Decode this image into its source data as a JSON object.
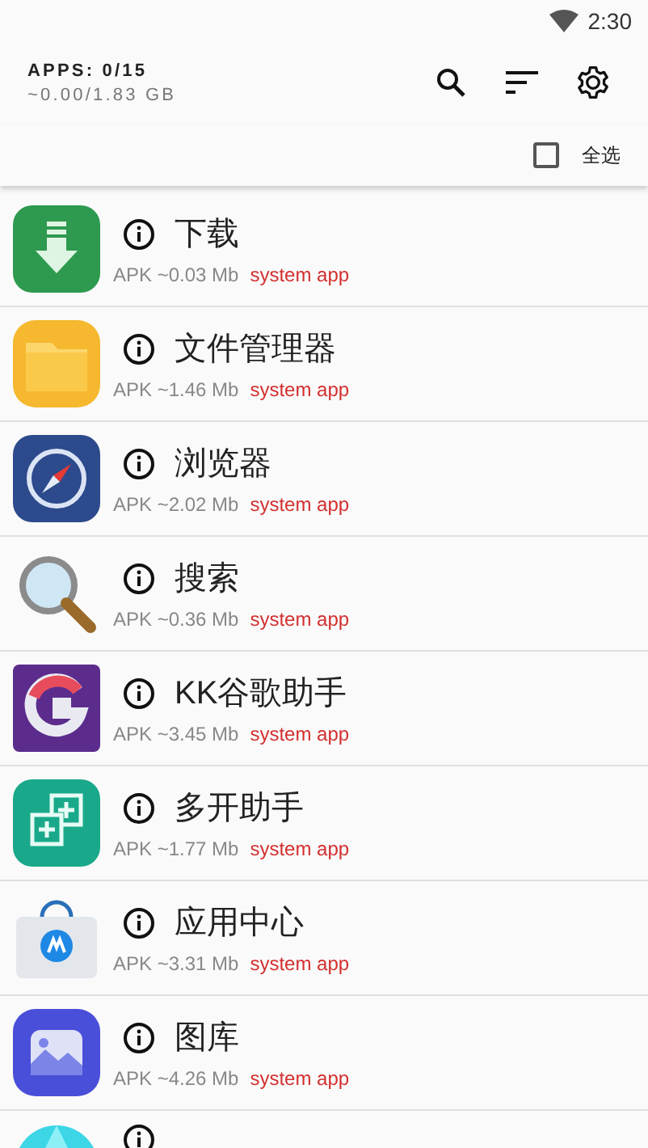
{
  "status_bar": {
    "time": "2:30"
  },
  "header": {
    "title": "APPS: 0/15",
    "subtitle": "~0.00/1.83 GB"
  },
  "select_all": {
    "label": "全选",
    "checked": false
  },
  "apps": [
    {
      "name": "下载",
      "size": "APK ~0.03 Mb",
      "tag": "system app",
      "kind": "download"
    },
    {
      "name": "文件管理器",
      "size": "APK ~1.46 Mb",
      "tag": "system app",
      "kind": "folder"
    },
    {
      "name": "浏览器",
      "size": "APK ~2.02 Mb",
      "tag": "system app",
      "kind": "compass"
    },
    {
      "name": "搜索",
      "size": "APK ~0.36 Mb",
      "tag": "system app",
      "kind": "magnifier"
    },
    {
      "name": "KK谷歌助手",
      "size": "APK ~3.45 Mb",
      "tag": "system app",
      "kind": "letter"
    },
    {
      "name": "多开助手",
      "size": "APK ~1.77 Mb",
      "tag": "system app",
      "kind": "multi"
    },
    {
      "name": "应用中心",
      "size": "APK ~3.31 Mb",
      "tag": "system app",
      "kind": "store"
    },
    {
      "name": "图库",
      "size": "APK ~4.26 Mb",
      "tag": "system app",
      "kind": "gallery"
    },
    {
      "kind": "camera"
    }
  ]
}
